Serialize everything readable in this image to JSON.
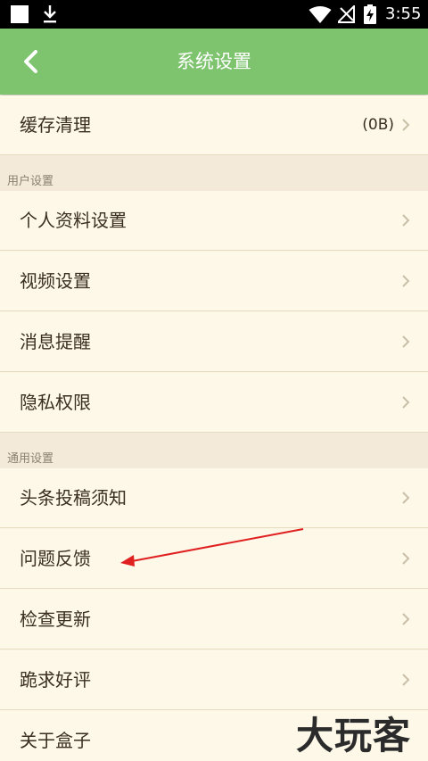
{
  "status_bar": {
    "time": "3:55"
  },
  "toolbar": {
    "title": "系统设置"
  },
  "cache": {
    "label": "缓存清理",
    "value": "(0B)"
  },
  "sections": {
    "user": {
      "header": "用户设置",
      "items": [
        "个人资料设置",
        "视频设置",
        "消息提醒",
        "隐私权限"
      ]
    },
    "general": {
      "header": "通用设置",
      "items": [
        "头条投稿须知",
        "问题反馈",
        "检查更新",
        "跪求好评",
        "关于盒子"
      ]
    }
  },
  "watermark": "大玩客",
  "colors": {
    "toolbar": "#7ec46f",
    "background": "#fbf6e4",
    "annotation_arrow": "#e02020"
  }
}
